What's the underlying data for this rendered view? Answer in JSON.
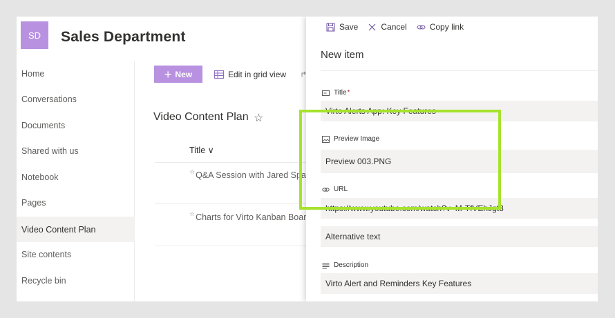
{
  "site": {
    "logo_initials": "SD",
    "title": "Sales Department"
  },
  "nav": {
    "items": [
      {
        "label": "Home"
      },
      {
        "label": "Conversations"
      },
      {
        "label": "Documents"
      },
      {
        "label": "Shared with us"
      },
      {
        "label": "Notebook"
      },
      {
        "label": "Pages"
      },
      {
        "label": "Video Content Plan",
        "selected": true
      },
      {
        "label": "Site contents"
      },
      {
        "label": "Recycle bin"
      }
    ]
  },
  "command_bar": {
    "new_label": "New",
    "grid_view_label": "Edit in grid view"
  },
  "list": {
    "title": "Video Content Plan",
    "star": "☆",
    "title_column": "Title ∨",
    "new_marker": "☆",
    "rows": [
      {
        "title": "Q&A Session with Jared Spataro"
      },
      {
        "title": "Charts for Virto Kanban Board"
      }
    ]
  },
  "panel": {
    "toolbar": {
      "save_label": "Save",
      "cancel_label": "Cancel",
      "copy_link_label": "Copy link"
    },
    "title": "New item",
    "fields": {
      "title": {
        "label": "Title",
        "required_mark": "*",
        "value": "Virto Alerts App: Key Features"
      },
      "preview_image": {
        "label": "Preview Image",
        "value": "Preview 003.PNG"
      },
      "url": {
        "label": "URL",
        "value": "https://www.youtube.com/watch?v=M-TfVEhJgt8"
      },
      "alt_text": {
        "value": "Alternative text"
      },
      "description": {
        "label": "Description",
        "value": "Virto Alert and Reminders Key Features"
      }
    }
  },
  "colors": {
    "accent": "#b892e0",
    "highlight": "#a6e22e",
    "field_bg": "#f3f2f1"
  }
}
